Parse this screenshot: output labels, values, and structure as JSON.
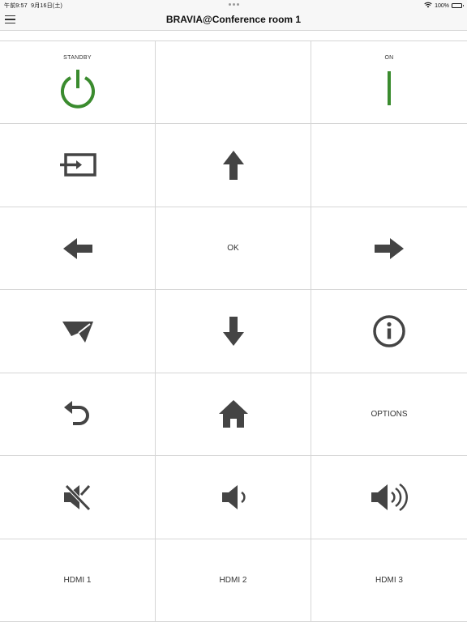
{
  "status_bar": {
    "time": "午前9:57",
    "date": "9月16日(土)",
    "battery": "100%"
  },
  "nav": {
    "title": "BRAVIA@Conference room 1"
  },
  "remote": {
    "standby_label": "STANDBY",
    "on_label": "ON",
    "ok_label": "OK",
    "options_label": "OPTIONS",
    "hdmi1_label": "HDMI 1",
    "hdmi2_label": "HDMI 2",
    "hdmi3_label": "HDMI 3"
  },
  "colors": {
    "power_green": "#3a8b2e",
    "icon_dark": "#444444"
  },
  "icons": [
    "menu-icon",
    "power-icon",
    "on-icon",
    "input-icon",
    "arrow-up-icon",
    "arrow-left-icon",
    "arrow-right-icon",
    "arrow-down-icon",
    "send-icon",
    "info-icon",
    "back-icon",
    "home-icon",
    "mute-icon",
    "volume-down-icon",
    "volume-up-icon",
    "wifi-icon",
    "battery-icon"
  ]
}
